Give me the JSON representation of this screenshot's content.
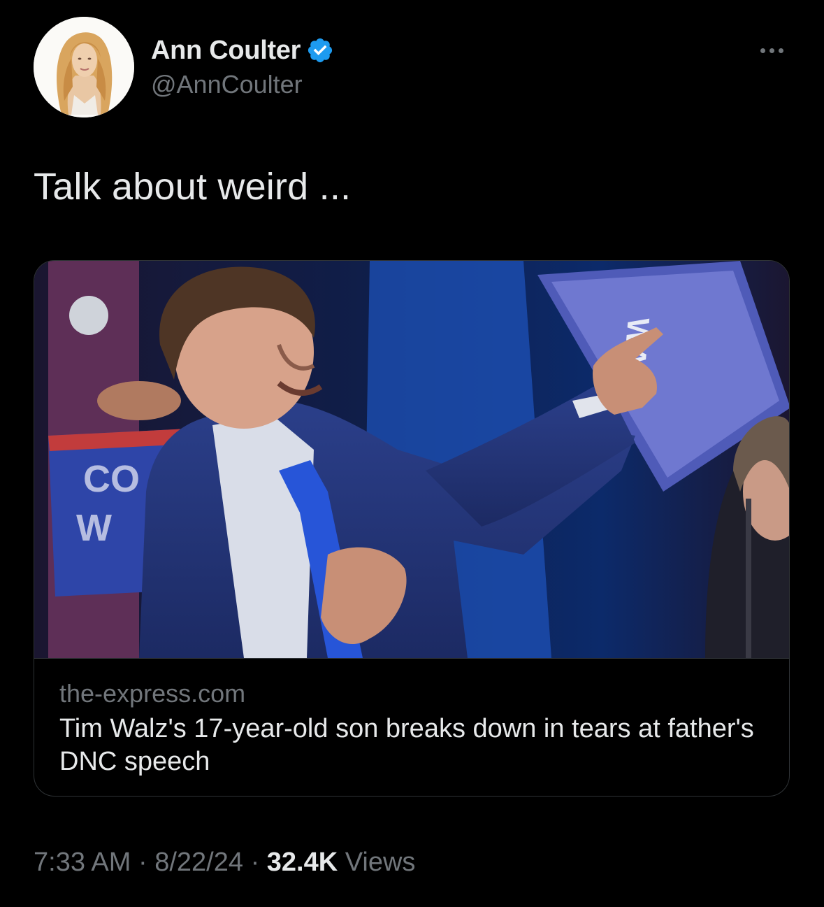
{
  "tweet": {
    "author": {
      "display_name": "Ann Coulter",
      "handle": "@AnnCoulter",
      "verified": true,
      "verified_badge_color": "#1d9bf0"
    },
    "text": "Talk about weird ...",
    "link_card": {
      "domain": "the-express.com",
      "title": "Tim Walz's 17-year-old son breaks down in tears at father's DNC speech"
    },
    "meta": {
      "time": "7:33 AM",
      "separator": "·",
      "date": "8/22/24",
      "views_count": "32.4K",
      "views_label": "Views"
    }
  },
  "icons": {
    "verified": "verified-badge-icon",
    "more": "more-options-icon"
  },
  "colors": {
    "background": "#000000",
    "primary_text": "#e7e9ea",
    "secondary_text": "#71767b",
    "border": "#2f3336",
    "accent": "#1d9bf0"
  }
}
